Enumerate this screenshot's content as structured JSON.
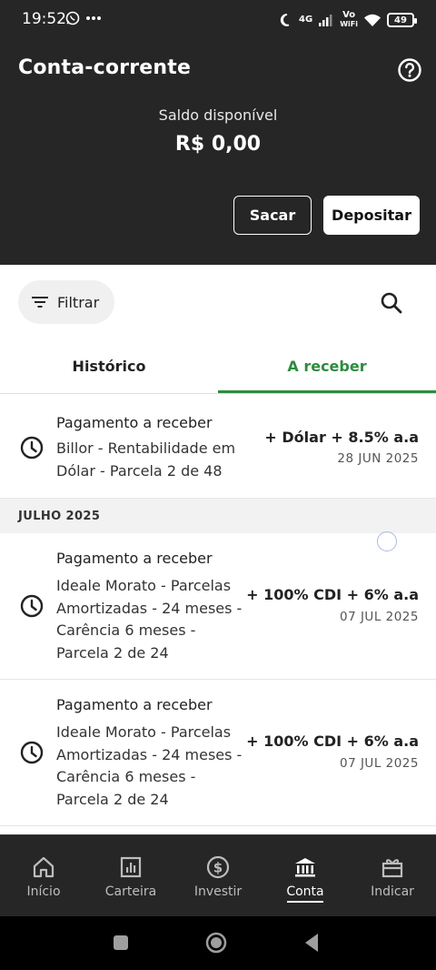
{
  "status_bar": {
    "time": "19:52",
    "network": "4G",
    "volte": "Vo",
    "wifi_label": "WiFi",
    "battery": "49"
  },
  "header": {
    "title": "Conta-corrente",
    "saldo_label": "Saldo disponível",
    "saldo_value": "R$ 0,00",
    "withdraw_label": "Sacar",
    "deposit_label": "Depositar"
  },
  "filter": {
    "label": "Filtrar"
  },
  "tabs": [
    {
      "label": "Histórico",
      "active": false
    },
    {
      "label": "A receber",
      "active": true
    }
  ],
  "items_june": [
    {
      "title": "Pagamento a receber",
      "desc": "Billor - Rentabilidade em Dólar - Parcela 2 de 48",
      "amount": "+ Dólar + 8.5% a.a",
      "date": "28 JUN 2025"
    }
  ],
  "section": {
    "label": "JULHO 2025"
  },
  "items_july": [
    {
      "title": "Pagamento a receber",
      "desc": "Ideale Morato - Parcelas Amortizadas - 24 meses - Carência 6 meses - Parcela 2 de 24",
      "amount": "+ 100% CDI + 6% a.a",
      "date": "07 JUL 2025"
    },
    {
      "title": "Pagamento a receber",
      "desc": "Ideale Morato - Parcelas Amortizadas - 24 meses - Carência 6 meses - Parcela 2 de 24",
      "amount": "+ 100% CDI + 6% a.a",
      "date": "07 JUL 2025"
    }
  ],
  "nav": [
    {
      "label": "Início",
      "icon": "home-icon",
      "active": false
    },
    {
      "label": "Carteira",
      "icon": "chart-icon",
      "active": false
    },
    {
      "label": "Investir",
      "icon": "dollar-icon",
      "active": false
    },
    {
      "label": "Conta",
      "icon": "bank-icon",
      "active": true
    },
    {
      "label": "Indicar",
      "icon": "gift-icon",
      "active": false
    }
  ],
  "colors": {
    "header_bg": "#262626",
    "accent_green": "#2e8b3e",
    "section_bg": "#f2f2f2"
  }
}
